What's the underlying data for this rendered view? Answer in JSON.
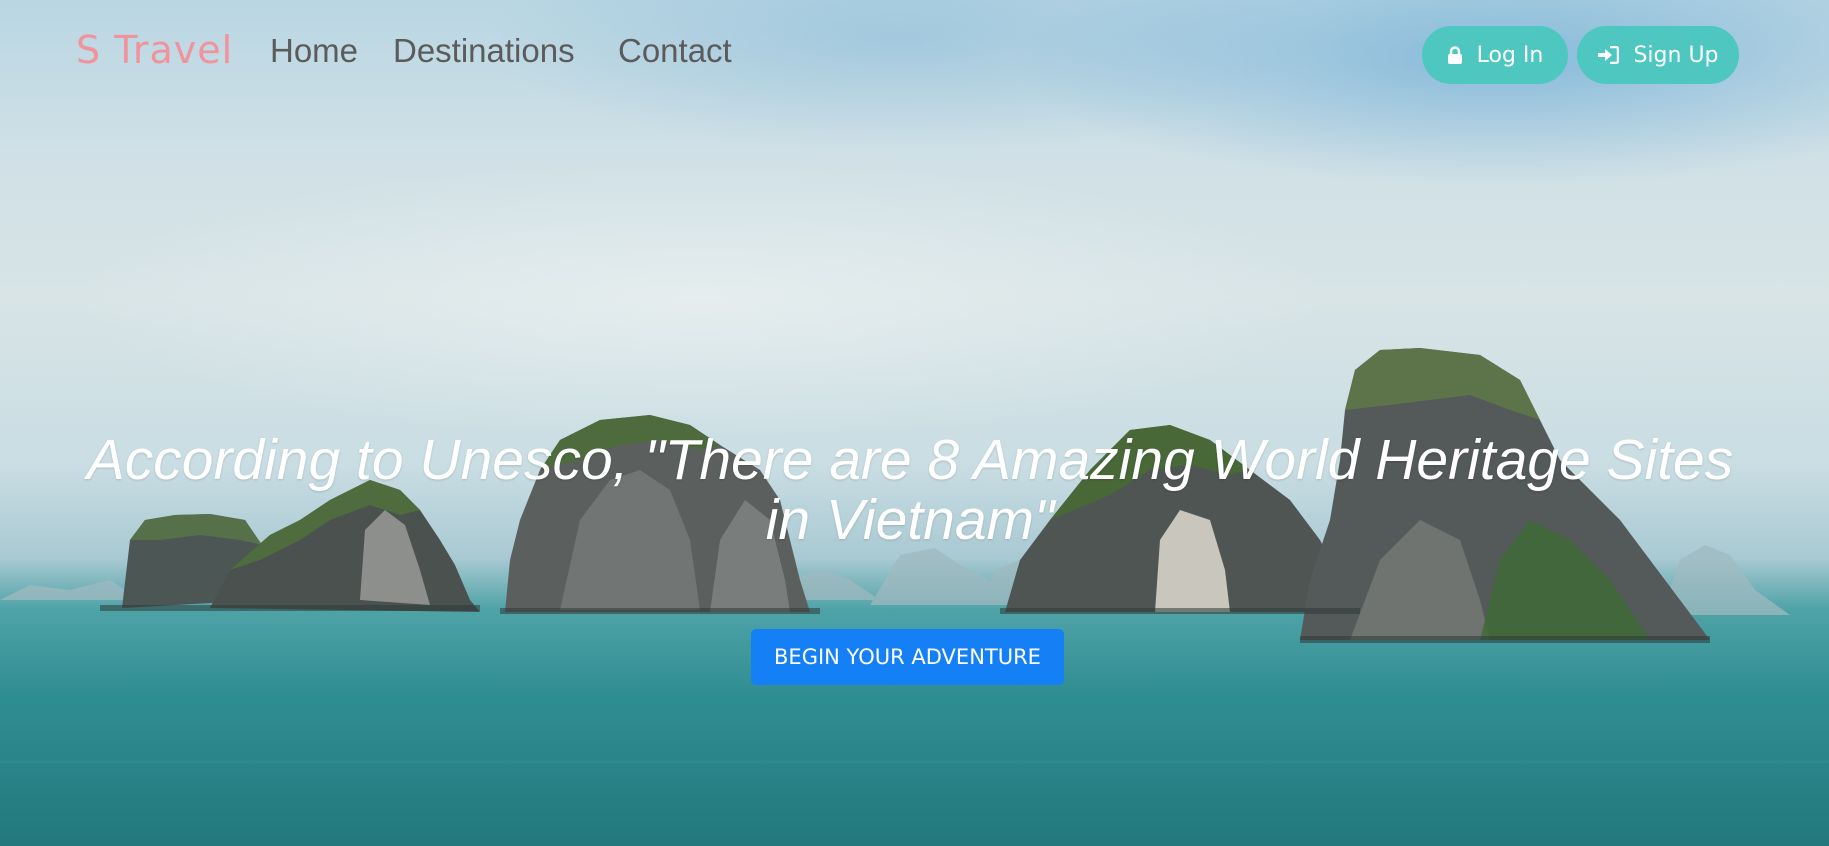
{
  "nav": {
    "brand": "S Travel",
    "links": [
      {
        "label": "Home"
      },
      {
        "label": "Destinations"
      },
      {
        "label": "Contact"
      }
    ],
    "login_label": "Log In",
    "signup_label": "Sign Up",
    "login_icon": "lock-icon",
    "signup_icon": "sign-in-icon"
  },
  "hero": {
    "headline": "According to Unesco, \"There are 8 Amazing World Heritage Sites in Vietnam\"",
    "cta_label": "BEGIN YOUR ADVENTURE"
  },
  "colors": {
    "brand": "#f0939b",
    "pill": "#4ec7c1",
    "cta": "#1580f5",
    "nav_text": "#5b5b5b"
  }
}
